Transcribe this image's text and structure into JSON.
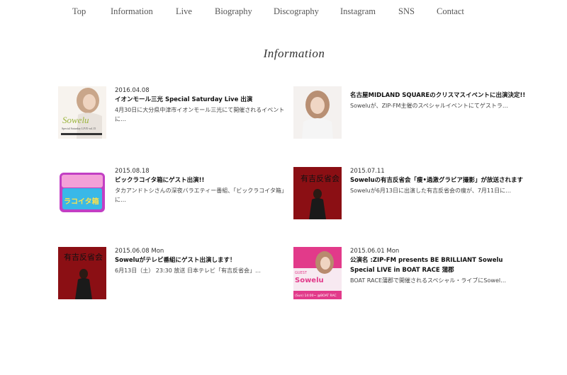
{
  "nav": {
    "items": [
      {
        "label": "Top"
      },
      {
        "label": "Information"
      },
      {
        "label": "Live"
      },
      {
        "label": "Biography"
      },
      {
        "label": "Discography"
      },
      {
        "label": "Instagram"
      },
      {
        "label": "SNS"
      },
      {
        "label": "Contact"
      }
    ]
  },
  "section": {
    "title": "Information"
  },
  "posts": [
    {
      "date": "2016.04.08",
      "title": "イオンモール三光 Special Saturday Live 出演",
      "excerpt": "4月30日に大分県中津市イオンモール三光にて開催されるイベントに…",
      "thumb_text": "Sowelu",
      "thumb_sub": "Special Saturday LIVE vol.15"
    },
    {
      "date": "",
      "title": "名古屋MIDLAND SQUAREのクリスマスイベントに出演決定!!",
      "excerpt": "Soweluが、ZIP-FM主催のスペシャルイベントにてゲストラ…"
    },
    {
      "date": "2015.08.18",
      "title": "ビックラコイタ箱にゲスト出演!!",
      "excerpt": "タカアンドトシさんの深夜バラエティー番組、「ビックラコイタ箱」に…",
      "thumb_text": "ラコイタ箱"
    },
    {
      "date": "2015.07.11",
      "title": "Soweluの有吉反省会「痩•過激グラビア撮影」が放送されます",
      "excerpt": "Soweluが6月13日に出演した有吉反省会の痩が、7月11日に…",
      "thumb_text": "有吉反省会"
    },
    {
      "date": "2015.06.08 Mon",
      "title": "Soweluがテレビ番組にゲスト出演します！",
      "excerpt": "6月13日（土） 23:30 放送 日本テレビ「有吉反省会」…",
      "thumb_text": "有吉反省会"
    },
    {
      "date": "2015.06.01 Mon",
      "title": "公演名 :ZIP-FM presents BE BRILLIANT Sowelu Special LIVE in BOAT RACE 蒲郡",
      "excerpt": "BOAT RACE蒲郡で開催されるスペシャル・ライブにSowel…",
      "thumb_text": "Sowelu",
      "thumb_sub": "GUEST",
      "thumb_foot": "(Sun) 14:00~ @BOAT RAC"
    }
  ],
  "colors": {
    "accent": "#e23a8a",
    "dark_red": "#8b0f14",
    "bg": "#ffffff"
  }
}
